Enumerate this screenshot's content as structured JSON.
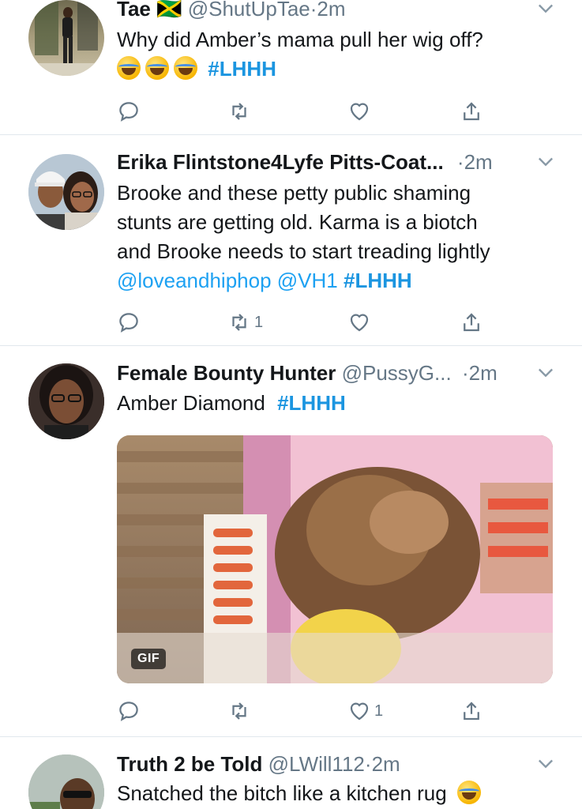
{
  "tweets": [
    {
      "name": "Tae 🇯🇲",
      "handle": "@ShutUpTae",
      "time": "2m",
      "text": "Why did Amber’s mama pull her wig off?",
      "hashtag": "#LHHH",
      "emoji_count": 3,
      "reply_count": "",
      "retweet_count": "",
      "like_count": ""
    },
    {
      "name": "Erika Flintstone4Lyfe Pitts-Coat...",
      "handle": "",
      "time": "2m",
      "text_lines": [
        "Brooke and these petty public shaming",
        "stunts are getting old. Karma is a biotch",
        "and Brooke needs to start treading lightly"
      ],
      "mention1": "@loveandhiphop",
      "mention2": "@VH1",
      "hashtag": "#LHHH",
      "reply_count": "",
      "retweet_count": "1",
      "like_count": ""
    },
    {
      "name": "Female Bounty Hunter",
      "handle": "@PussyG...",
      "time": "2m",
      "text": "Amber Diamond",
      "hashtag": "#LHHH",
      "media_badge": "GIF",
      "reply_count": "",
      "retweet_count": "",
      "like_count": "1"
    },
    {
      "name": "Truth 2 be Told",
      "handle": "@LWill112",
      "time": "2m",
      "text": "Snatched the bitch like a kitchen rug"
    }
  ],
  "separator": "·",
  "icons": {
    "reply": "reply-icon",
    "retweet": "retweet-icon",
    "like": "heart-icon",
    "share": "share-icon",
    "caret": "chevron-down-icon"
  },
  "colors": {
    "link": "#1da1f2",
    "muted": "#657786",
    "divider": "#e1e8ed"
  }
}
